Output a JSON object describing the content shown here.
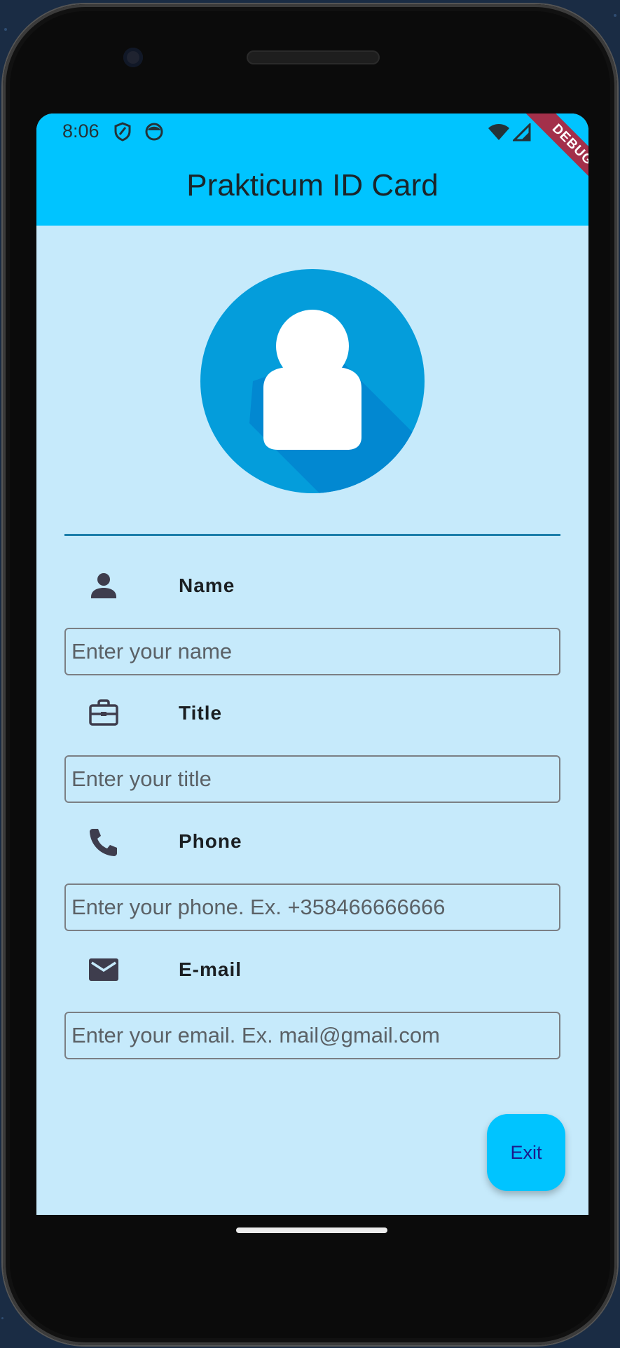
{
  "status_bar": {
    "time": "8:06",
    "icons": [
      "shield-icon",
      "face-icon",
      "wifi-icon",
      "signal-icon"
    ]
  },
  "app_bar": {
    "title": "Prakticum ID Card",
    "debug_banner": "DEBUG"
  },
  "avatar": {
    "icon": "person-avatar-icon"
  },
  "fields": [
    {
      "label": "Name",
      "icon": "person-icon",
      "placeholder": "Enter your name",
      "value": ""
    },
    {
      "label": "Title",
      "icon": "briefcase-icon",
      "placeholder": "Enter your title",
      "value": ""
    },
    {
      "label": "Phone",
      "icon": "phone-icon",
      "placeholder": "Enter your phone. Ex. +358466666666",
      "value": ""
    },
    {
      "label": "E-mail",
      "icon": "mail-icon",
      "placeholder": "Enter your email. Ex. mail@gmail.com",
      "value": ""
    }
  ],
  "exit_button": {
    "label": "Exit"
  },
  "colors": {
    "app_bar": "#00c4ff",
    "background": "#c6eafb",
    "avatar": "#049ddb",
    "divider": "#1b7eaa",
    "exit_text": "#1c1a8a",
    "debug_ribbon": "#a3304a"
  }
}
